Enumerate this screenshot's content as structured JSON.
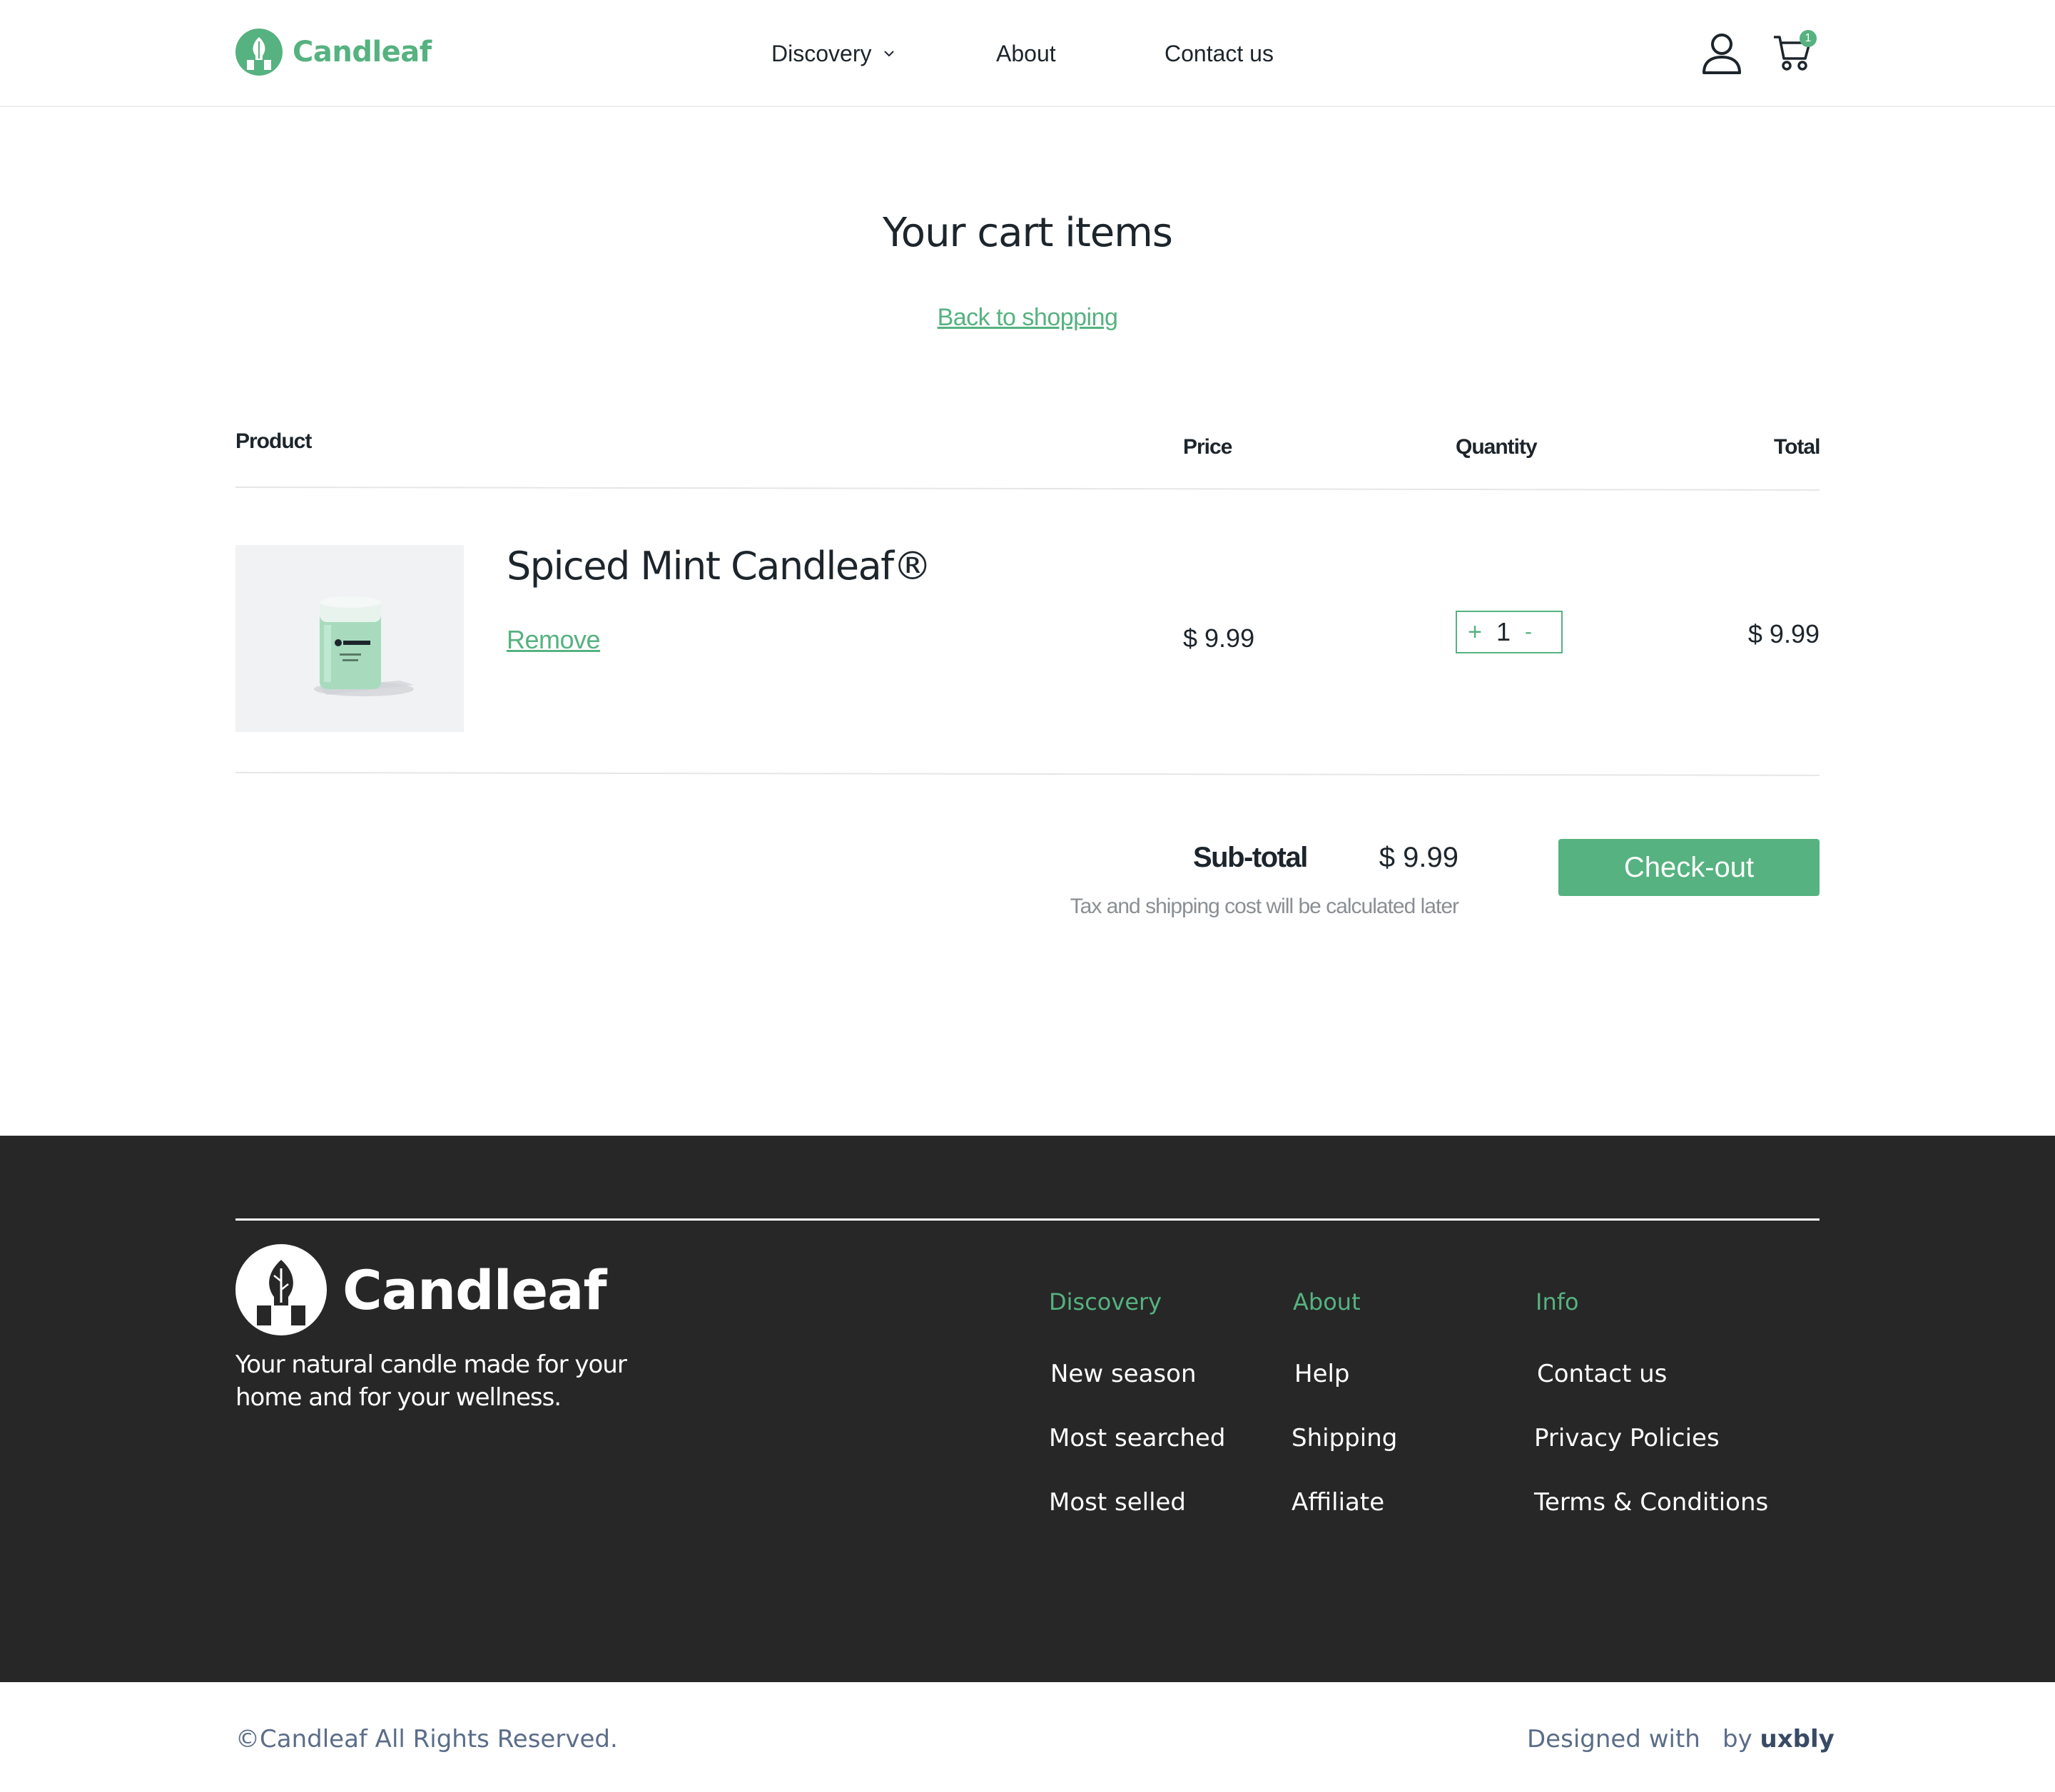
{
  "brand": {
    "name": "Candleaf",
    "accent_color": "#56b280"
  },
  "header": {
    "nav": [
      {
        "label": "Discovery",
        "has_dropdown": true
      },
      {
        "label": "About"
      },
      {
        "label": "Contact us"
      }
    ],
    "icons": {
      "user": "user-icon",
      "cart": "cart-icon"
    },
    "cart_count": "1"
  },
  "cart": {
    "title": "Your cart items",
    "back_link": "Back to shopping",
    "columns": {
      "product": "Product",
      "price": "Price",
      "quantity": "Quantity",
      "total": "Total"
    },
    "items": [
      {
        "name": "Spiced Mint Candleaf®",
        "remove_label": "Remove",
        "price": "$ 9.99",
        "quantity": "1",
        "total": "$ 9.99",
        "qty_plus": "+",
        "qty_minus": "-"
      }
    ],
    "subtotal_label": "Sub-total",
    "subtotal_value": "$ 9.99",
    "tax_note": "Tax and shipping cost will be calculated later",
    "checkout_label": "Check-out"
  },
  "footer": {
    "tagline": "Your natural candle made for your home and for your wellness.",
    "columns": [
      {
        "title": "Discovery",
        "links": [
          "New season",
          "Most searched",
          "Most selled"
        ]
      },
      {
        "title": "About",
        "links": [
          "Help",
          "Shipping",
          "Affiliate"
        ]
      },
      {
        "title": "Info",
        "links": [
          "Contact us",
          "Privacy Policies",
          "Terms & Conditions"
        ]
      }
    ],
    "copyright": "©Candleaf All Rights Reserved.",
    "designed_with": "Designed with",
    "by_label": "by",
    "by_name": "uxbly"
  }
}
